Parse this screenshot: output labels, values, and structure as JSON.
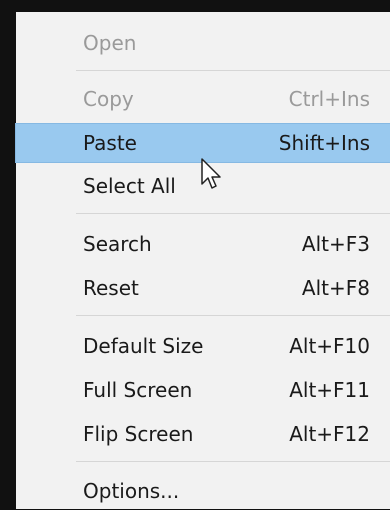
{
  "menu": {
    "items": [
      {
        "label": "Open",
        "shortcut": "",
        "disabled": true
      },
      {
        "label": "Copy",
        "shortcut": "Ctrl+Ins",
        "disabled": true
      },
      {
        "label": "Paste",
        "shortcut": "Shift+Ins",
        "highlighted": true
      },
      {
        "label": "Select All",
        "shortcut": ""
      },
      {
        "label": "Search",
        "shortcut": "Alt+F3"
      },
      {
        "label": "Reset",
        "shortcut": "Alt+F8"
      },
      {
        "label": "Default Size",
        "shortcut": "Alt+F10"
      },
      {
        "label": "Full Screen",
        "shortcut": "Alt+F11"
      },
      {
        "label": "Flip Screen",
        "shortcut": "Alt+F12"
      },
      {
        "label": "Options...",
        "shortcut": ""
      }
    ],
    "highlight_color": "#99c9ef",
    "disabled_color": "#9a9a9a"
  },
  "cursor": {
    "icon": "arrow-pointer-icon"
  }
}
